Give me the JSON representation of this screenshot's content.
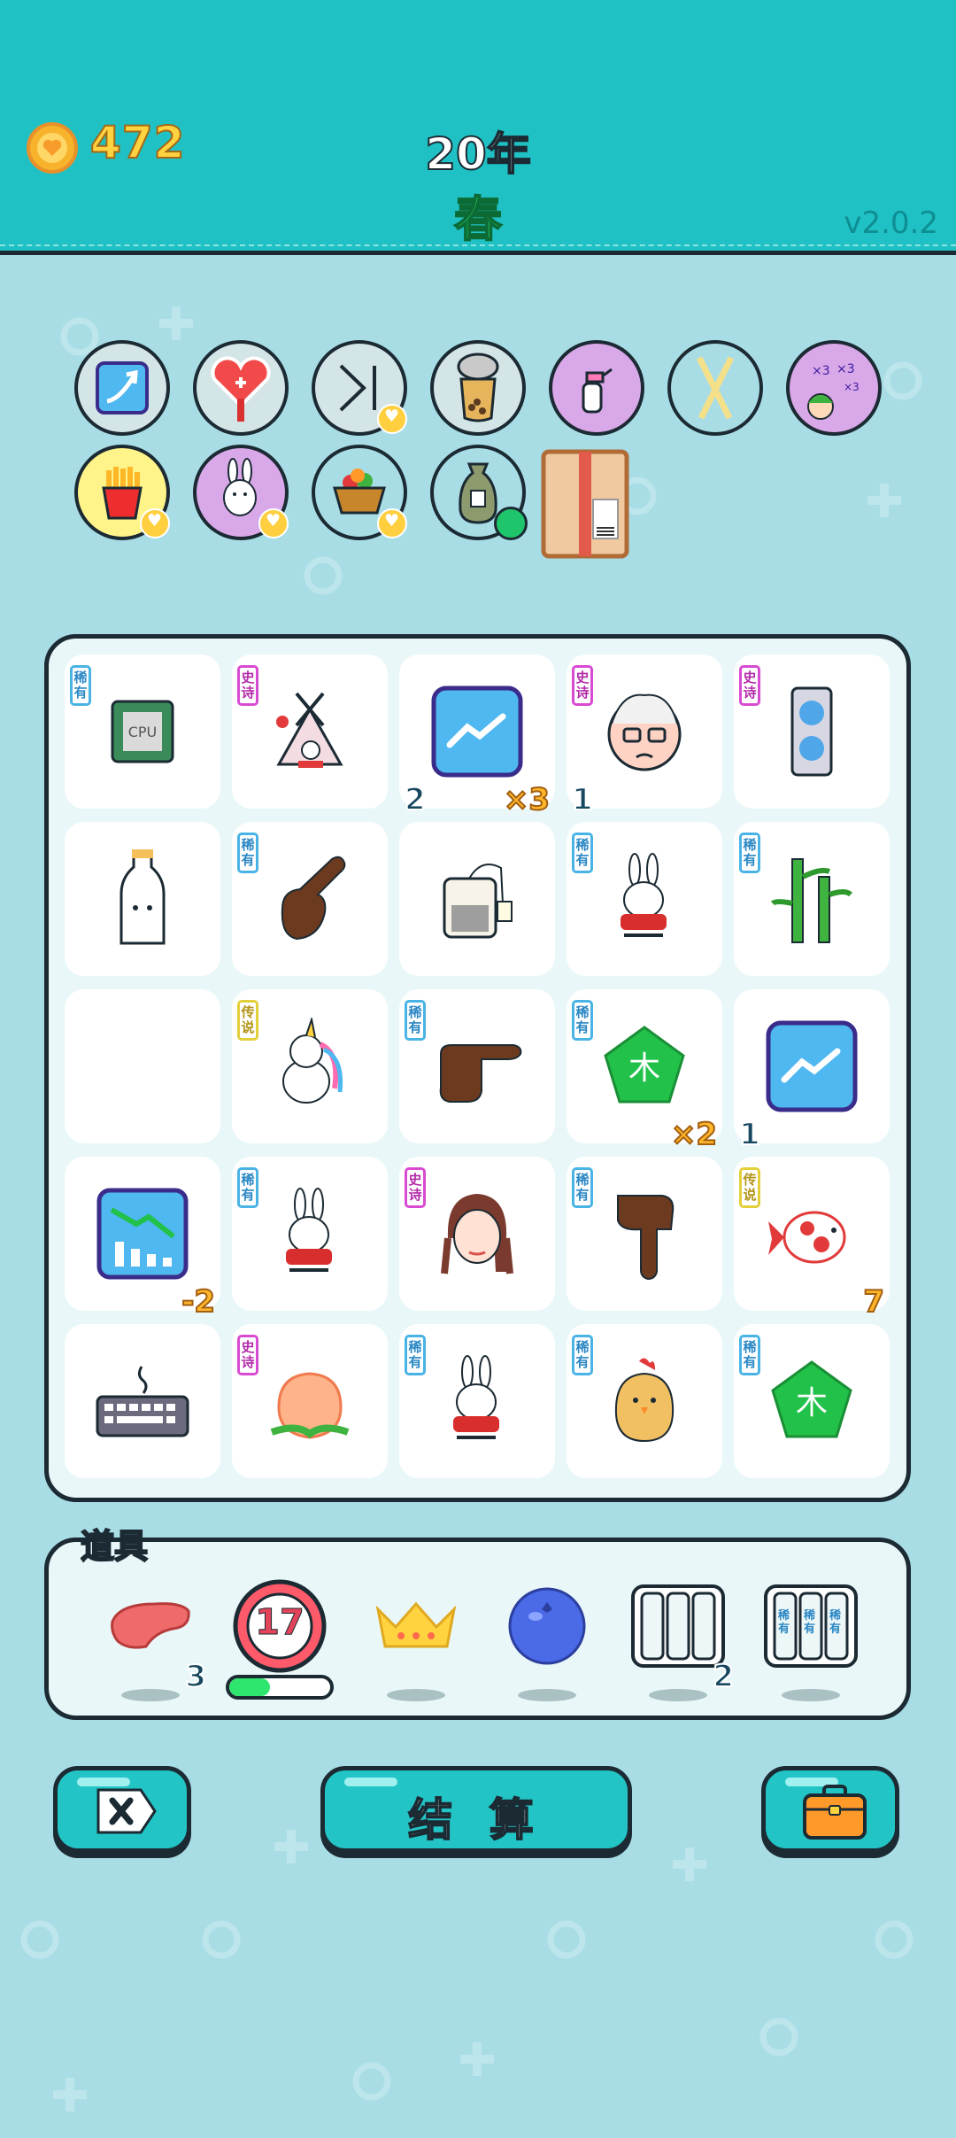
{
  "header": {
    "coins": "472",
    "year": "20年",
    "season": "春",
    "version": "v2.0.2",
    "coin_icon": "coin-heart-icon"
  },
  "owned_items": [
    {
      "name": "upgrade-arrow-card",
      "bg": "#d4e5e7",
      "heart": false
    },
    {
      "name": "heart-fan",
      "bg": "#d4e5e7",
      "heart": false
    },
    {
      "name": "skip-forward",
      "bg": "#d4e5e7",
      "heart": true
    },
    {
      "name": "bubble-tea",
      "bg": "#d4e5e7",
      "heart": false
    },
    {
      "name": "spray-bottle",
      "bg": "#d9a8e8",
      "heart": false
    },
    {
      "name": "chopsticks",
      "bg": "#a9dde6",
      "heart": false
    },
    {
      "name": "math-genius",
      "bg": "#d9a8e8",
      "heart": false
    },
    {
      "name": "french-fries",
      "bg": "#fff48a",
      "heart": true
    },
    {
      "name": "bunny",
      "bg": "#d9a8e8",
      "heart": true
    },
    {
      "name": "fruit-basket",
      "bg": "#a9dde6",
      "heart": true
    },
    {
      "name": "rice-sack",
      "bg": "#a9dde6",
      "heart": false
    },
    {
      "name": "cardboard-box",
      "bg": "transparent",
      "heart": false
    }
  ],
  "board": {
    "cells": [
      {
        "name": "cpu",
        "tag": "稀有",
        "rarity": "rare",
        "bl": "",
        "br": ""
      },
      {
        "name": "bunny-tent",
        "tag": "史诗",
        "rarity": "epic",
        "bl": "",
        "br": ""
      },
      {
        "name": "upgrade-card",
        "tag": "",
        "rarity": "",
        "bl": "2",
        "br": "×3"
      },
      {
        "name": "grandpa",
        "tag": "史诗",
        "rarity": "epic",
        "bl": "1",
        "br": ""
      },
      {
        "name": "graphics-card",
        "tag": "史诗",
        "rarity": "epic",
        "bl": "",
        "br": ""
      },
      {
        "name": "milk-bottle",
        "tag": "",
        "rarity": "",
        "bl": "",
        "br": ""
      },
      {
        "name": "hand-point-up-right",
        "tag": "稀有",
        "rarity": "rare",
        "bl": "",
        "br": ""
      },
      {
        "name": "tea-bag",
        "tag": "",
        "rarity": "",
        "bl": "",
        "br": ""
      },
      {
        "name": "bunny-red",
        "tag": "稀有",
        "rarity": "rare",
        "bl": "",
        "br": ""
      },
      {
        "name": "bamboo",
        "tag": "稀有",
        "rarity": "rare",
        "bl": "",
        "br": ""
      },
      {
        "name": "empty",
        "tag": "",
        "rarity": "",
        "bl": "",
        "br": ""
      },
      {
        "name": "unicorn",
        "tag": "传说",
        "rarity": "legend",
        "bl": "",
        "br": ""
      },
      {
        "name": "hand-point-right",
        "tag": "稀有",
        "rarity": "rare",
        "bl": "",
        "br": ""
      },
      {
        "name": "wood-element",
        "tag": "稀有",
        "rarity": "rare",
        "bl": "",
        "br": "×2"
      },
      {
        "name": "upgrade-card",
        "tag": "",
        "rarity": "",
        "bl": "1",
        "br": ""
      },
      {
        "name": "downtrend-chart",
        "tag": "",
        "rarity": "",
        "bl": "",
        "br": "-2"
      },
      {
        "name": "bunny-red",
        "tag": "稀有",
        "rarity": "rare",
        "bl": "",
        "br": ""
      },
      {
        "name": "braided-girl",
        "tag": "史诗",
        "rarity": "epic",
        "bl": "",
        "br": ""
      },
      {
        "name": "hand-point-down",
        "tag": "稀有",
        "rarity": "rare",
        "bl": "",
        "br": ""
      },
      {
        "name": "koi-fish",
        "tag": "传说",
        "rarity": "legend",
        "bl": "",
        "br": "7"
      },
      {
        "name": "keyboard",
        "tag": "",
        "rarity": "",
        "bl": "",
        "br": ""
      },
      {
        "name": "peach",
        "tag": "史诗",
        "rarity": "epic",
        "bl": "",
        "br": ""
      },
      {
        "name": "bunny-red",
        "tag": "稀有",
        "rarity": "rare",
        "bl": "",
        "br": ""
      },
      {
        "name": "chick",
        "tag": "稀有",
        "rarity": "rare",
        "bl": "",
        "br": ""
      },
      {
        "name": "wood-element",
        "tag": "稀有",
        "rarity": "rare",
        "bl": "",
        "br": ""
      }
    ],
    "wood_char": "木",
    "cpu_label": "CPU"
  },
  "tools": {
    "title": "道具",
    "items": [
      {
        "name": "liver",
        "count": "3"
      },
      {
        "name": "timer",
        "count": "",
        "value": "17"
      },
      {
        "name": "crown",
        "count": ""
      },
      {
        "name": "blueberry",
        "count": ""
      },
      {
        "name": "three-slots",
        "count": "2"
      },
      {
        "name": "rare-slots",
        "count": "",
        "labels": [
          "稀有",
          "稀有",
          "稀有"
        ]
      }
    ],
    "timer_progress": 0.4
  },
  "buttons": {
    "close_icon": "close-x-icon",
    "settle_label": "结 算",
    "bag_icon": "briefcase-icon"
  }
}
